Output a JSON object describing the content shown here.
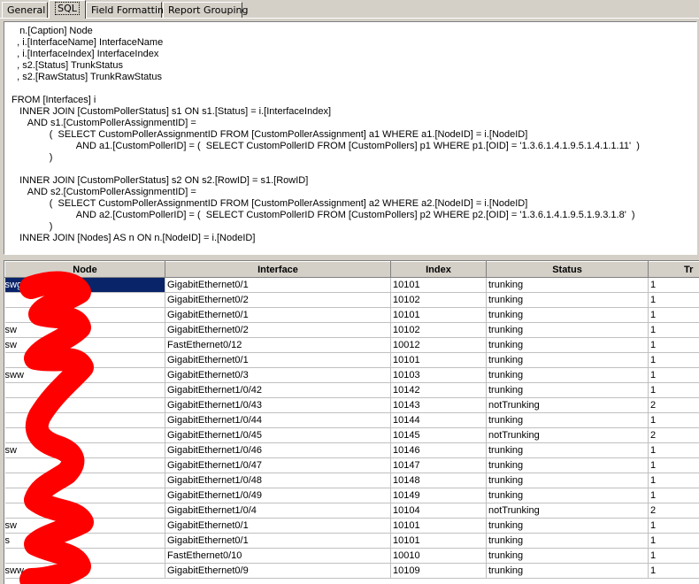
{
  "tabs": [
    {
      "label": "General"
    },
    {
      "label": "SQL"
    },
    {
      "label": "Field Formatting"
    },
    {
      "label": "Report Grouping"
    }
  ],
  "sql": {
    "text": "   n.[Caption] Node\n  , i.[InterfaceName] InterfaceName\n  , i.[InterfaceIndex] InterfaceIndex\n  , s2.[Status] TrunkStatus\n  , s2.[RawStatus] TrunkRawStatus\n\nFROM [Interfaces] i\n   INNER JOIN [CustomPollerStatus] s1 ON s1.[Status] = i.[InterfaceIndex]\n      AND s1.[CustomPollerAssignmentID] =\n              (  SELECT CustomPollerAssignmentID FROM [CustomPollerAssignment] a1 WHERE a1.[NodeID] = i.[NodeID]\n                        AND a1.[CustomPollerID] = (  SELECT CustomPollerID FROM [CustomPollers] p1 WHERE p1.[OID] = '1.3.6.1.4.1.9.5.1.4.1.1.11'  )\n              )\n\n   INNER JOIN [CustomPollerStatus] s2 ON s2.[RowID] = s1.[RowID]\n      AND s2.[CustomPollerAssignmentID] =\n              (  SELECT CustomPollerAssignmentID FROM [CustomPollerAssignment] a2 WHERE a2.[NodeID] = i.[NodeID]\n                        AND a2.[CustomPollerID] = (  SELECT CustomPollerID FROM [CustomPollers] p2 WHERE p2.[OID] = '1.3.6.1.4.1.9.5.1.9.3.1.8'  )\n              )\n   INNER JOIN [Nodes] AS n ON n.[NodeID] = i.[NodeID]"
  },
  "grid": {
    "columns": [
      "Node",
      "Interface",
      "Index",
      "Status",
      "Tr"
    ],
    "rows": [
      {
        "node": "swg",
        "interface": "GigabitEthernet0/1",
        "index": "10101",
        "status": "trunking",
        "raw": "1"
      },
      {
        "node": "",
        "interface": "GigabitEthernet0/2",
        "index": "10102",
        "status": "trunking",
        "raw": "1"
      },
      {
        "node": "",
        "interface": "GigabitEthernet0/1",
        "index": "10101",
        "status": "trunking",
        "raw": "1"
      },
      {
        "node": "sw",
        "interface": "GigabitEthernet0/2",
        "index": "10102",
        "status": "trunking",
        "raw": "1"
      },
      {
        "node": "sw",
        "interface": "FastEthernet0/12",
        "index": "10012",
        "status": "trunking",
        "raw": "1"
      },
      {
        "node": "",
        "interface": "GigabitEthernet0/1",
        "index": "10101",
        "status": "trunking",
        "raw": "1"
      },
      {
        "node": "sww",
        "interface": "GigabitEthernet0/3",
        "index": "10103",
        "status": "trunking",
        "raw": "1"
      },
      {
        "node": "",
        "interface": "GigabitEthernet1/0/42",
        "index": "10142",
        "status": "trunking",
        "raw": "1"
      },
      {
        "node": "",
        "interface": "GigabitEthernet1/0/43",
        "index": "10143",
        "status": "notTrunking",
        "raw": "2"
      },
      {
        "node": "",
        "interface": "GigabitEthernet1/0/44",
        "index": "10144",
        "status": "trunking",
        "raw": "1"
      },
      {
        "node": "",
        "interface": "GigabitEthernet1/0/45",
        "index": "10145",
        "status": "notTrunking",
        "raw": "2"
      },
      {
        "node": "sw",
        "interface": "GigabitEthernet1/0/46",
        "index": "10146",
        "status": "trunking",
        "raw": "1"
      },
      {
        "node": "",
        "interface": "GigabitEthernet1/0/47",
        "index": "10147",
        "status": "trunking",
        "raw": "1"
      },
      {
        "node": "",
        "interface": "GigabitEthernet1/0/48",
        "index": "10148",
        "status": "trunking",
        "raw": "1"
      },
      {
        "node": "",
        "interface": "GigabitEthernet1/0/49",
        "index": "10149",
        "status": "trunking",
        "raw": "1"
      },
      {
        "node": "",
        "interface": "GigabitEthernet1/0/4",
        "index": "10104",
        "status": "notTrunking",
        "raw": "2"
      },
      {
        "node": "sw",
        "interface": "GigabitEthernet0/1",
        "index": "10101",
        "status": "trunking",
        "raw": "1"
      },
      {
        "node": "s",
        "interface": "GigabitEthernet0/1",
        "index": "10101",
        "status": "trunking",
        "raw": "1"
      },
      {
        "node": "",
        "interface": "FastEthernet0/10",
        "index": "10010",
        "status": "trunking",
        "raw": "1"
      },
      {
        "node": "sww",
        "interface": "GigabitEthernet0/9",
        "index": "10109",
        "status": "trunking",
        "raw": "1"
      }
    ]
  },
  "colors": {
    "selection": "#0a246a",
    "redaction": "#ff0000"
  }
}
